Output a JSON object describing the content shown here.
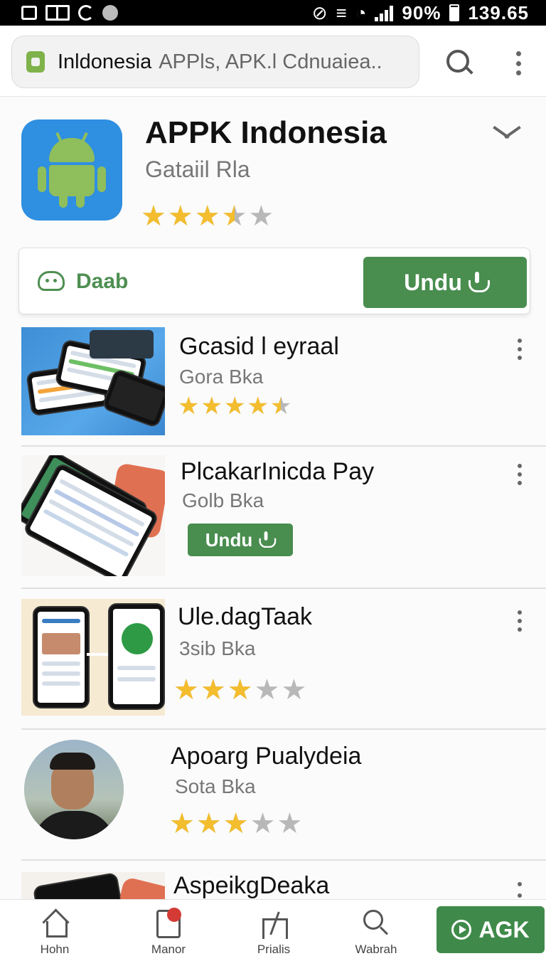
{
  "status_bar": {
    "battery": "90%",
    "time": "139.65"
  },
  "search": {
    "query_bold": "Inldonesia",
    "query_rest": "APPls, APK.l Cdnuaiea.."
  },
  "featured": {
    "title": "APPK Indonesia",
    "subtitle": "Gataiil Rla",
    "rating": 3.5,
    "action_label": "Daab",
    "install_label": "Undu"
  },
  "apps": [
    {
      "title": "Gcasid l eyraal",
      "subtitle": "Gora Bka",
      "rating": 4.5
    },
    {
      "title": "PlcakarInicda Pay",
      "subtitle": "Golb Bka",
      "button": "Undu"
    },
    {
      "title": "Ule.dagTaak",
      "subtitle": "3sib Bka",
      "rating": 3
    },
    {
      "title": "Apoarg Pualydeia",
      "subtitle": "Sota Bka",
      "rating": 3
    },
    {
      "title": "AspeikgDeaka"
    }
  ],
  "bottom_nav": [
    {
      "label": "Hohn",
      "icon": "home-icon"
    },
    {
      "label": "Manor",
      "icon": "manor-icon"
    },
    {
      "label": "Prialis",
      "icon": "prialis-icon"
    },
    {
      "label": "Wabrah",
      "icon": "search-icon"
    }
  ],
  "cta": {
    "label": "AGK",
    "icon": "play-icon"
  },
  "colors": {
    "accent_green": "#498d4f",
    "star": "#f3bd2e",
    "app_icon_blue": "#2f8fe0"
  }
}
